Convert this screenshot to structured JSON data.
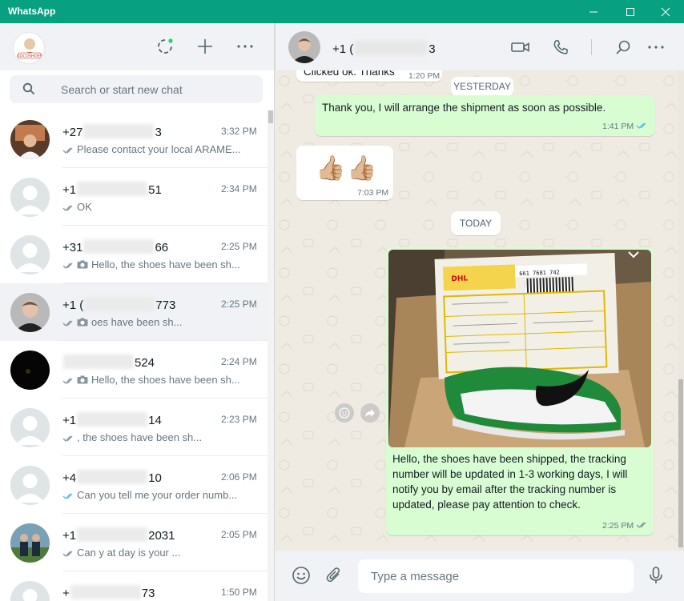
{
  "window": {
    "title": "WhatsApp"
  },
  "colors": {
    "accent": "#07a080",
    "outgoing_bubble": "#d9fdd3",
    "read_ticks": "#53bdeb",
    "chat_bg": "#efeae2"
  },
  "sidebar": {
    "header_icons": [
      "status-icon",
      "new-chat-icon",
      "menu-icon"
    ],
    "my_avatar_text": "COCOSHOES",
    "search": {
      "placeholder": "Search or start new chat"
    },
    "chats": [
      {
        "name": "+27",
        "name_suffix": "3",
        "time": "3:32 PM",
        "preview": "Please contact your local ARAME...",
        "ticks": "grey",
        "avatar": "photo"
      },
      {
        "name": "+1",
        "name_suffix": "51",
        "time": "2:34 PM",
        "preview": "OK",
        "ticks": "grey",
        "avatar": "default"
      },
      {
        "name": "+31",
        "name_suffix": "66",
        "time": "2:25 PM",
        "preview": "Hello, the shoes have been sh...",
        "ticks": "grey",
        "avatar": "default",
        "has_photo_icon": true
      },
      {
        "name": "+1 (",
        "name_suffix": "773",
        "time": "2:25 PM",
        "preview": "oes have been sh...",
        "ticks": "grey",
        "avatar": "person",
        "has_photo_icon": true,
        "active": true
      },
      {
        "name": "",
        "name_suffix": "524",
        "time": "2:24 PM",
        "preview": "Hello, the shoes have been sh...",
        "ticks": "grey",
        "avatar": "dark",
        "has_photo_icon": true
      },
      {
        "name": "+1",
        "name_suffix": "14",
        "time": "2:23 PM",
        "preview": ", the shoes have been sh...",
        "ticks": "grey",
        "avatar": "default"
      },
      {
        "name": "+4",
        "name_suffix": "10",
        "time": "2:06 PM",
        "preview": "Can you tell me your order numb...",
        "ticks": "blue",
        "avatar": "default"
      },
      {
        "name": "+1",
        "name_suffix": "2031",
        "time": "2:05 PM",
        "preview": "Can y           at day is your ...",
        "ticks": "grey",
        "avatar": "group"
      },
      {
        "name": "+",
        "name_suffix": "73",
        "time": "1:50 PM",
        "preview": "",
        "ticks": "grey",
        "avatar": "default"
      }
    ]
  },
  "conversation": {
    "contact_name_prefix": "+1 (",
    "contact_name_suffix": "3",
    "header_icons": [
      "video-call-icon",
      "voice-call-icon",
      "search-icon",
      "menu-icon"
    ],
    "messages": [
      {
        "type": "in",
        "text": "Clicked ok. Thanks",
        "time": "1:20 PM"
      },
      {
        "type": "day",
        "text": "YESTERDAY"
      },
      {
        "type": "out",
        "text": "Thank you, I will arrange the shipment as soon as possible.",
        "time": "1:41 PM",
        "ticks": "blue"
      },
      {
        "type": "in",
        "text": "👍🏼👍🏼",
        "time": "7:03 PM"
      },
      {
        "type": "day",
        "text": "TODAY"
      },
      {
        "type": "out-image",
        "text": "Hello, the shoes have been shipped, the tracking number will be updated in 1-3 working days, I will notify you by email after the tracking number is updated, please pay attention to check.",
        "time": "2:25 PM",
        "ticks": "grey"
      }
    ],
    "image_label": {
      "carrier": "DHL",
      "barcode_number": "661 7681 742"
    }
  },
  "composer": {
    "placeholder": "Type a message"
  }
}
